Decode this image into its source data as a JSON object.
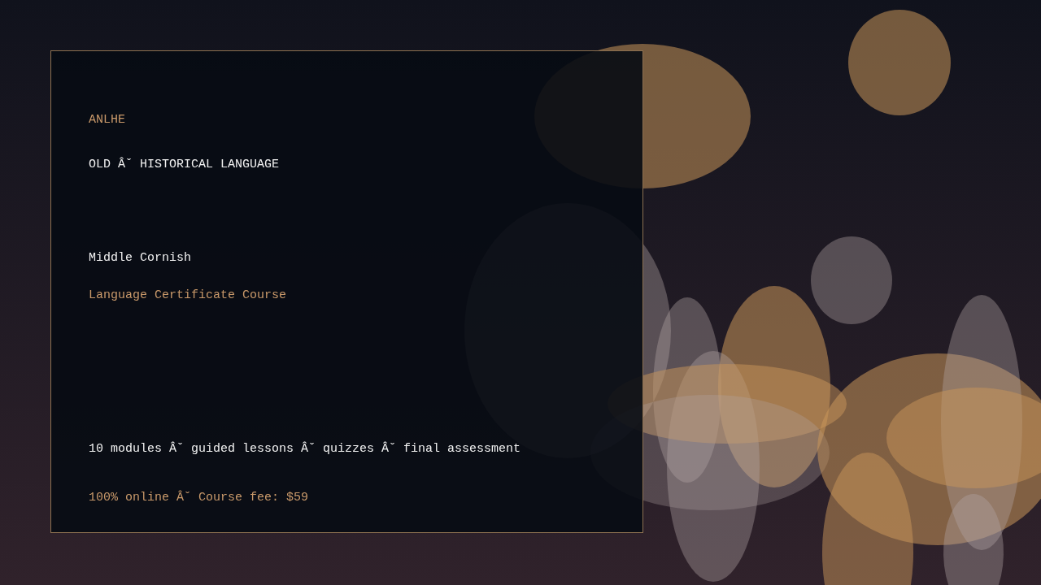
{
  "card": {
    "brand": "ANLHE",
    "category": "OLD Âˇ HISTORICAL LANGUAGE",
    "title": "Middle Cornish",
    "subtitle": "Language Certificate Course",
    "details": "10 modules Âˇ guided lessons Âˇ quizzes Âˇ final assessment",
    "pricing": "100% online Âˇ Course fee: $59"
  }
}
